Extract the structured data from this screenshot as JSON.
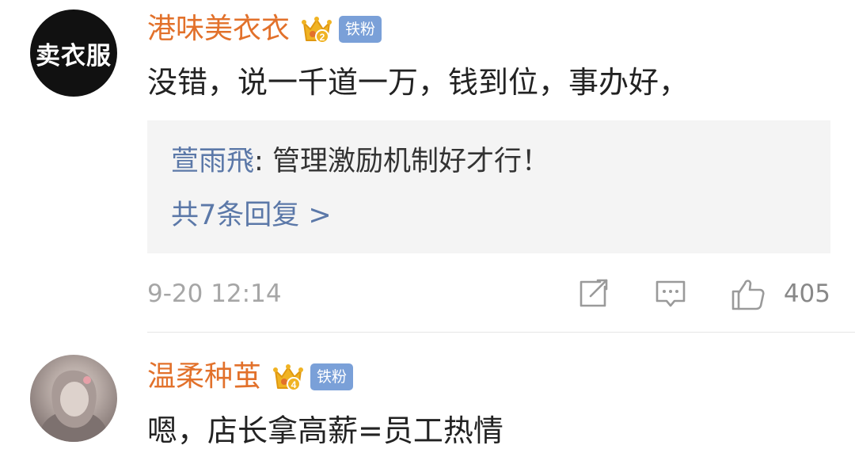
{
  "comments": [
    {
      "avatar_text": "卖衣服",
      "username": "港味美衣衣",
      "vip_level": "2",
      "fan_badge": "铁粉",
      "text": "没错，说一千道一万，钱到位，事办好，",
      "reply": {
        "user": "萱雨飛",
        "separator": ": ",
        "text": "管理激励机制好才行！",
        "more_label": "共7条回复 >"
      },
      "time": "9-20 12:14",
      "likes": "405"
    },
    {
      "username": "温柔种茧",
      "vip_level": "4",
      "fan_badge": "铁粉",
      "text": "嗯，店长拿高薪=员工热情"
    }
  ],
  "colors": {
    "username": "#e2712b",
    "reply_blue": "#5b78a8",
    "badge_blue": "#7aa0d8",
    "reply_bg": "#f4f4f4"
  },
  "icons": {
    "vip": "crown-icon",
    "share": "share-icon",
    "comment": "comment-icon",
    "like": "thumbs-up-icon"
  }
}
